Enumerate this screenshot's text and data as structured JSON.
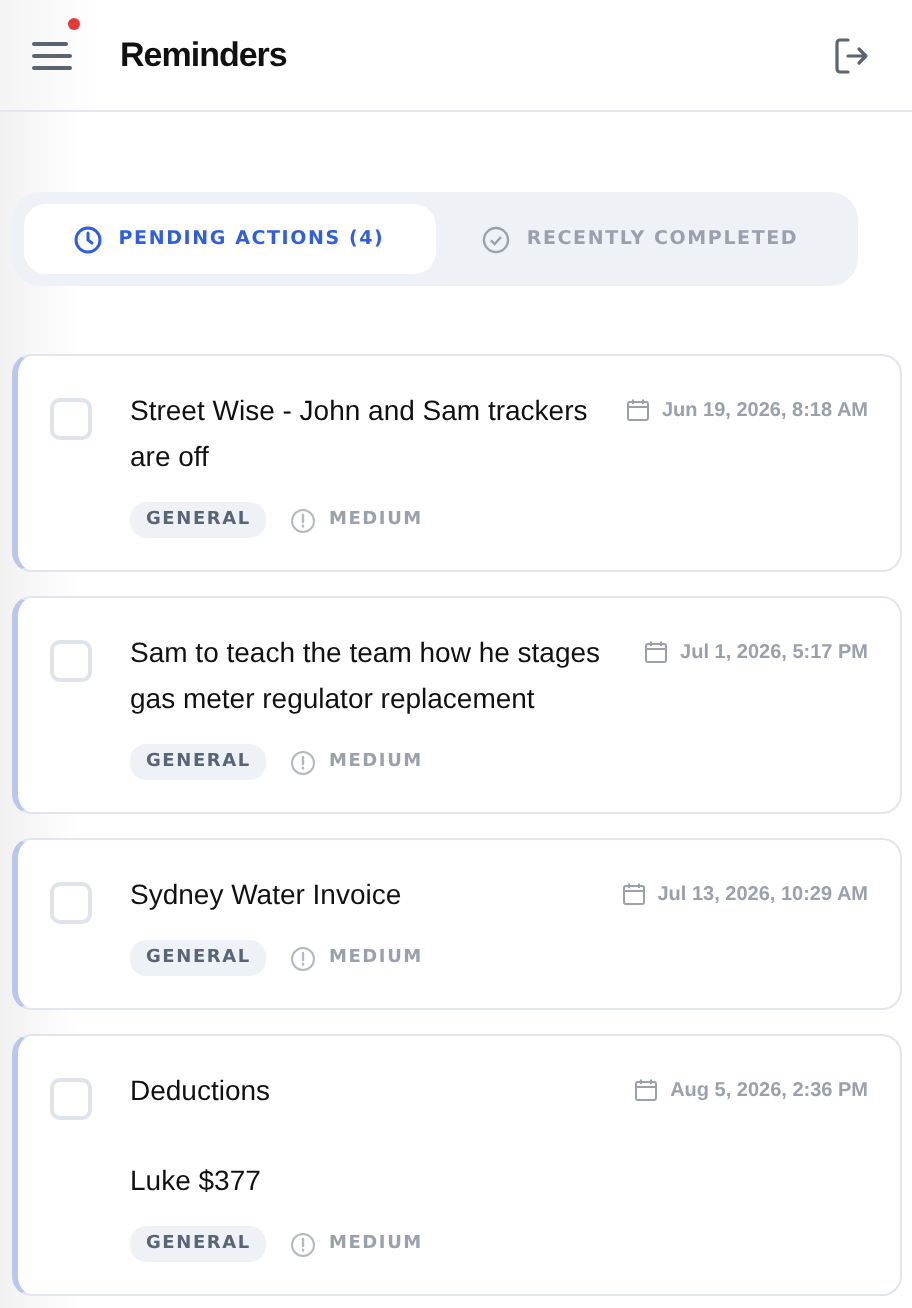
{
  "header": {
    "title": "Reminders",
    "menu_notification": true
  },
  "tabs": [
    {
      "label": "PENDING ACTIONS (4)",
      "selected": true
    },
    {
      "label": "RECENTLY COMPLETED",
      "selected": false
    }
  ],
  "reminders": [
    {
      "title": "Street Wise - John and Sam trackers are off",
      "due": "Jun 19, 2026, 8:18 AM",
      "category": "GENERAL",
      "priority": "MEDIUM",
      "checked": false
    },
    {
      "title": "Sam to teach the team how he stages gas meter regulator replacement",
      "due": "Jul 1, 2026, 5:17 PM",
      "category": "GENERAL",
      "priority": "MEDIUM",
      "checked": false
    },
    {
      "title": "Sydney Water Invoice",
      "due": "Jul 13, 2026, 10:29 AM",
      "category": "GENERAL",
      "priority": "MEDIUM",
      "checked": false
    },
    {
      "title": "Deductions",
      "note": "Luke $377",
      "due": "Aug 5, 2026, 2:36 PM",
      "category": "GENERAL",
      "priority": "MEDIUM",
      "checked": false
    }
  ]
}
